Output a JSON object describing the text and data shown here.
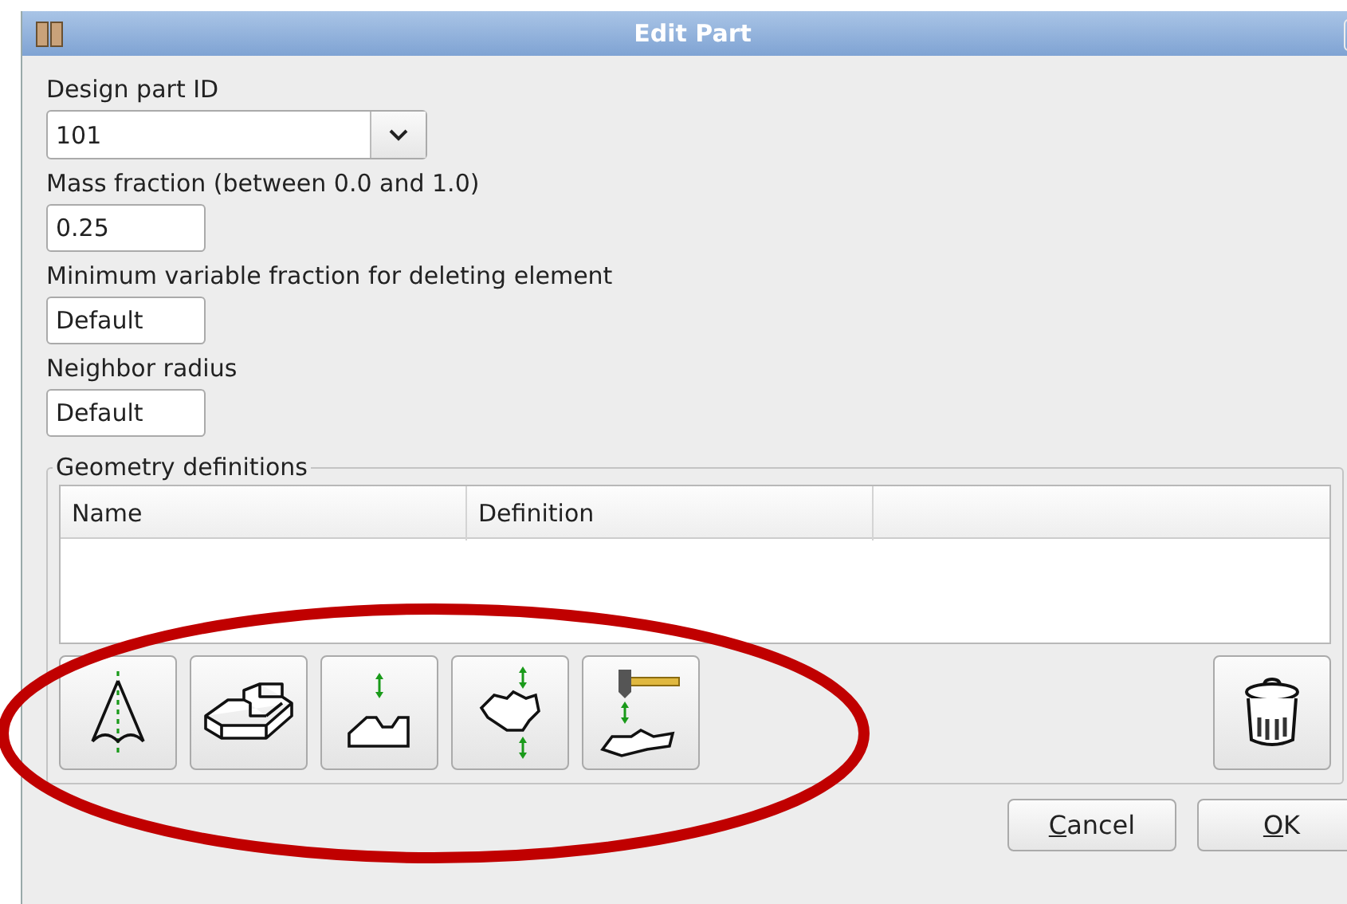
{
  "window": {
    "title": "Edit Part"
  },
  "fields": [
    {
      "kind": "combo",
      "label": "Design part ID",
      "value": "101"
    },
    {
      "kind": "text",
      "label": "Mass fraction (between 0.0 and 1.0)",
      "value": "0.25"
    },
    {
      "kind": "text",
      "label": "Minimum variable fraction for deleting element",
      "value": "Default"
    },
    {
      "kind": "text",
      "label": "Neighbor radius",
      "value": "Default"
    }
  ],
  "geometry": {
    "title": "Geometry definitions",
    "columns": [
      "Name",
      "Definition"
    ],
    "tools": [
      {
        "kind": "cone"
      },
      {
        "kind": "block"
      },
      {
        "kind": "profile"
      },
      {
        "kind": "blob"
      },
      {
        "kind": "stamp"
      }
    ]
  },
  "buttons": [
    "Cancel",
    "OK"
  ]
}
